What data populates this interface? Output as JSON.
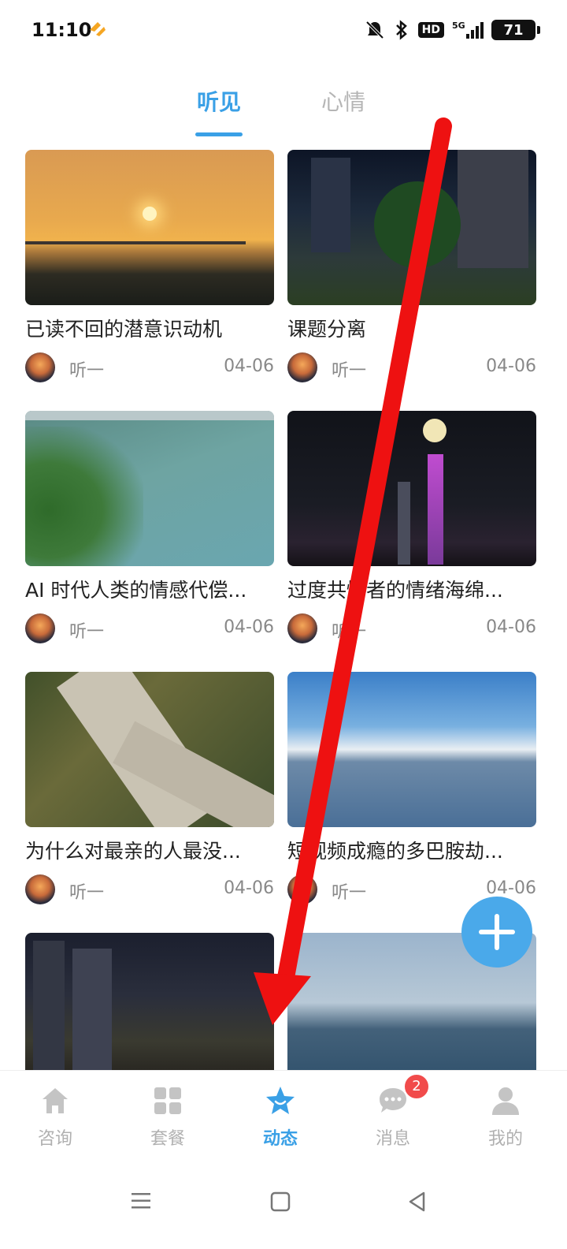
{
  "status_bar": {
    "time": "11:10",
    "network": "5G",
    "hd": "HD",
    "battery": "71"
  },
  "tabs": [
    {
      "label": "听见",
      "active": true
    },
    {
      "label": "心情",
      "active": false
    }
  ],
  "cards": [
    {
      "title": "已读不回的潜意识动机",
      "author": "听一",
      "date": "04-06",
      "image": "sunset-bridge"
    },
    {
      "title": "课题分离",
      "author": "听一",
      "date": "04-06",
      "image": "night-street"
    },
    {
      "title": "AI 时代人类的情感代偿...",
      "author": "听一",
      "date": "04-06",
      "image": "lake-aerial"
    },
    {
      "title": "过度共情者的情绪海绵...",
      "author": "听一",
      "date": "04-06",
      "image": "moon-skyline"
    },
    {
      "title": "为什么对最亲的人最没...",
      "author": "听一",
      "date": "04-06",
      "image": "boardwalk"
    },
    {
      "title": "短视频成瘾的多巴胺劫...",
      "author": "听一",
      "date": "04-06",
      "image": "bay-skyline"
    },
    {
      "title": "",
      "author": "",
      "date": "",
      "image": "night-towers"
    },
    {
      "title": "",
      "author": "",
      "date": "",
      "image": "sea-horizon"
    }
  ],
  "fab": {
    "icon": "plus-icon"
  },
  "bottom_nav": [
    {
      "label": "咨询",
      "icon": "home-icon",
      "active": false
    },
    {
      "label": "套餐",
      "icon": "grid-icon",
      "active": false
    },
    {
      "label": "动态",
      "icon": "star-icon",
      "active": true
    },
    {
      "label": "消息",
      "icon": "chat-icon",
      "active": false,
      "badge": "2"
    },
    {
      "label": "我的",
      "icon": "user-icon",
      "active": false
    }
  ],
  "colors": {
    "accent": "#3aa0e6",
    "inactive": "#b0b0b0",
    "badge": "#f14b4b",
    "annotation": "#ee1111"
  }
}
